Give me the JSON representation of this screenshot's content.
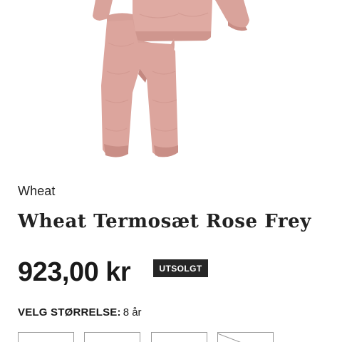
{
  "product": {
    "brand": "Wheat",
    "title": "Wheat Termosæt Rose Frey",
    "price": "923,00 kr",
    "stock_badge": "UTSOLGT",
    "image_icon": "thermal-suit-product-photo",
    "product_color": "#dba49c"
  },
  "size_selector": {
    "label": "VELG STØRRELSE:",
    "selected": "8 år",
    "option_count_visible": 4
  },
  "colors": {
    "text": "#1a1a1a",
    "badge_bg": "#262626",
    "badge_text": "#ffffff",
    "border": "#9a9a9a"
  }
}
